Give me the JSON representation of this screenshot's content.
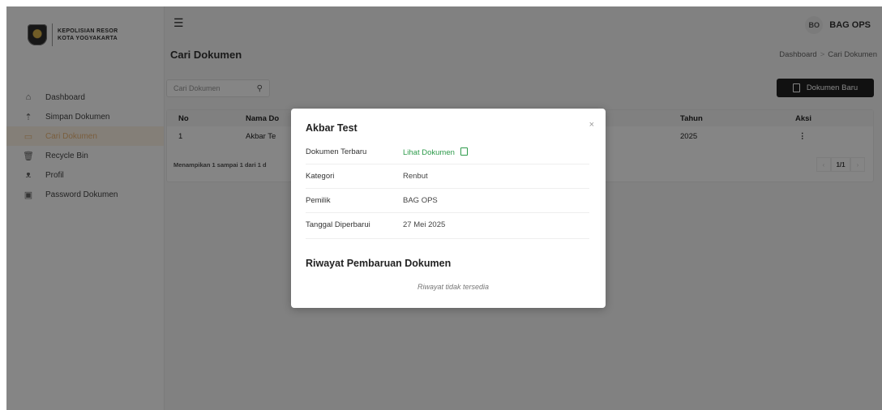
{
  "brand": {
    "line1": "KEPOLISIAN RESOR",
    "line2": "KOTA YOGYAKARTA"
  },
  "sidebar": {
    "items": [
      {
        "label": "Dashboard",
        "icon": "home-icon"
      },
      {
        "label": "Simpan Dokumen",
        "icon": "upload-icon"
      },
      {
        "label": "Cari Dokumen",
        "icon": "folder-icon",
        "active": true
      },
      {
        "label": "Recycle Bin",
        "icon": "trash-icon"
      },
      {
        "label": "Profil",
        "icon": "user-icon"
      },
      {
        "label": "Password Dokumen",
        "icon": "lock-file-icon"
      }
    ]
  },
  "header": {
    "avatar_initials": "BO",
    "user_name": "BAG OPS"
  },
  "page": {
    "title": "Cari Dokumen",
    "breadcrumb": {
      "parent": "Dashboard",
      "separator": ">",
      "current": "Cari Dokumen"
    }
  },
  "search": {
    "placeholder": "Cari Dokumen"
  },
  "new_button": {
    "label": "Dokumen Baru"
  },
  "table": {
    "headers": {
      "no": "No",
      "name": "Nama Do",
      "year": "Tahun",
      "action": "Aksi"
    },
    "rows": [
      {
        "no": "1",
        "name": "Akbar Te",
        "year": "2025",
        "action": "⋮"
      }
    ],
    "footer": "Menampikan 1 sampai 1 dari 1 d",
    "pager": {
      "prev": "‹",
      "current": "1/1",
      "next": "›"
    }
  },
  "modal": {
    "title": "Akbar Test",
    "close": "×",
    "rows": {
      "latest": {
        "label": "Dokumen Terbaru",
        "value": "Lihat Dokumen"
      },
      "category": {
        "label": "Kategori",
        "value": "Renbut"
      },
      "owner": {
        "label": "Pemilik",
        "value": "BAG OPS"
      },
      "updated": {
        "label": "Tanggal Diperbarui",
        "value": "27 Mei 2025"
      }
    },
    "history_title": "Riwayat Pembaruan Dokumen",
    "history_empty": "Riwayat tidak tersedia"
  },
  "colors": {
    "accent": "#e9b577",
    "link": "#2d9a4a",
    "button": "#222222"
  }
}
